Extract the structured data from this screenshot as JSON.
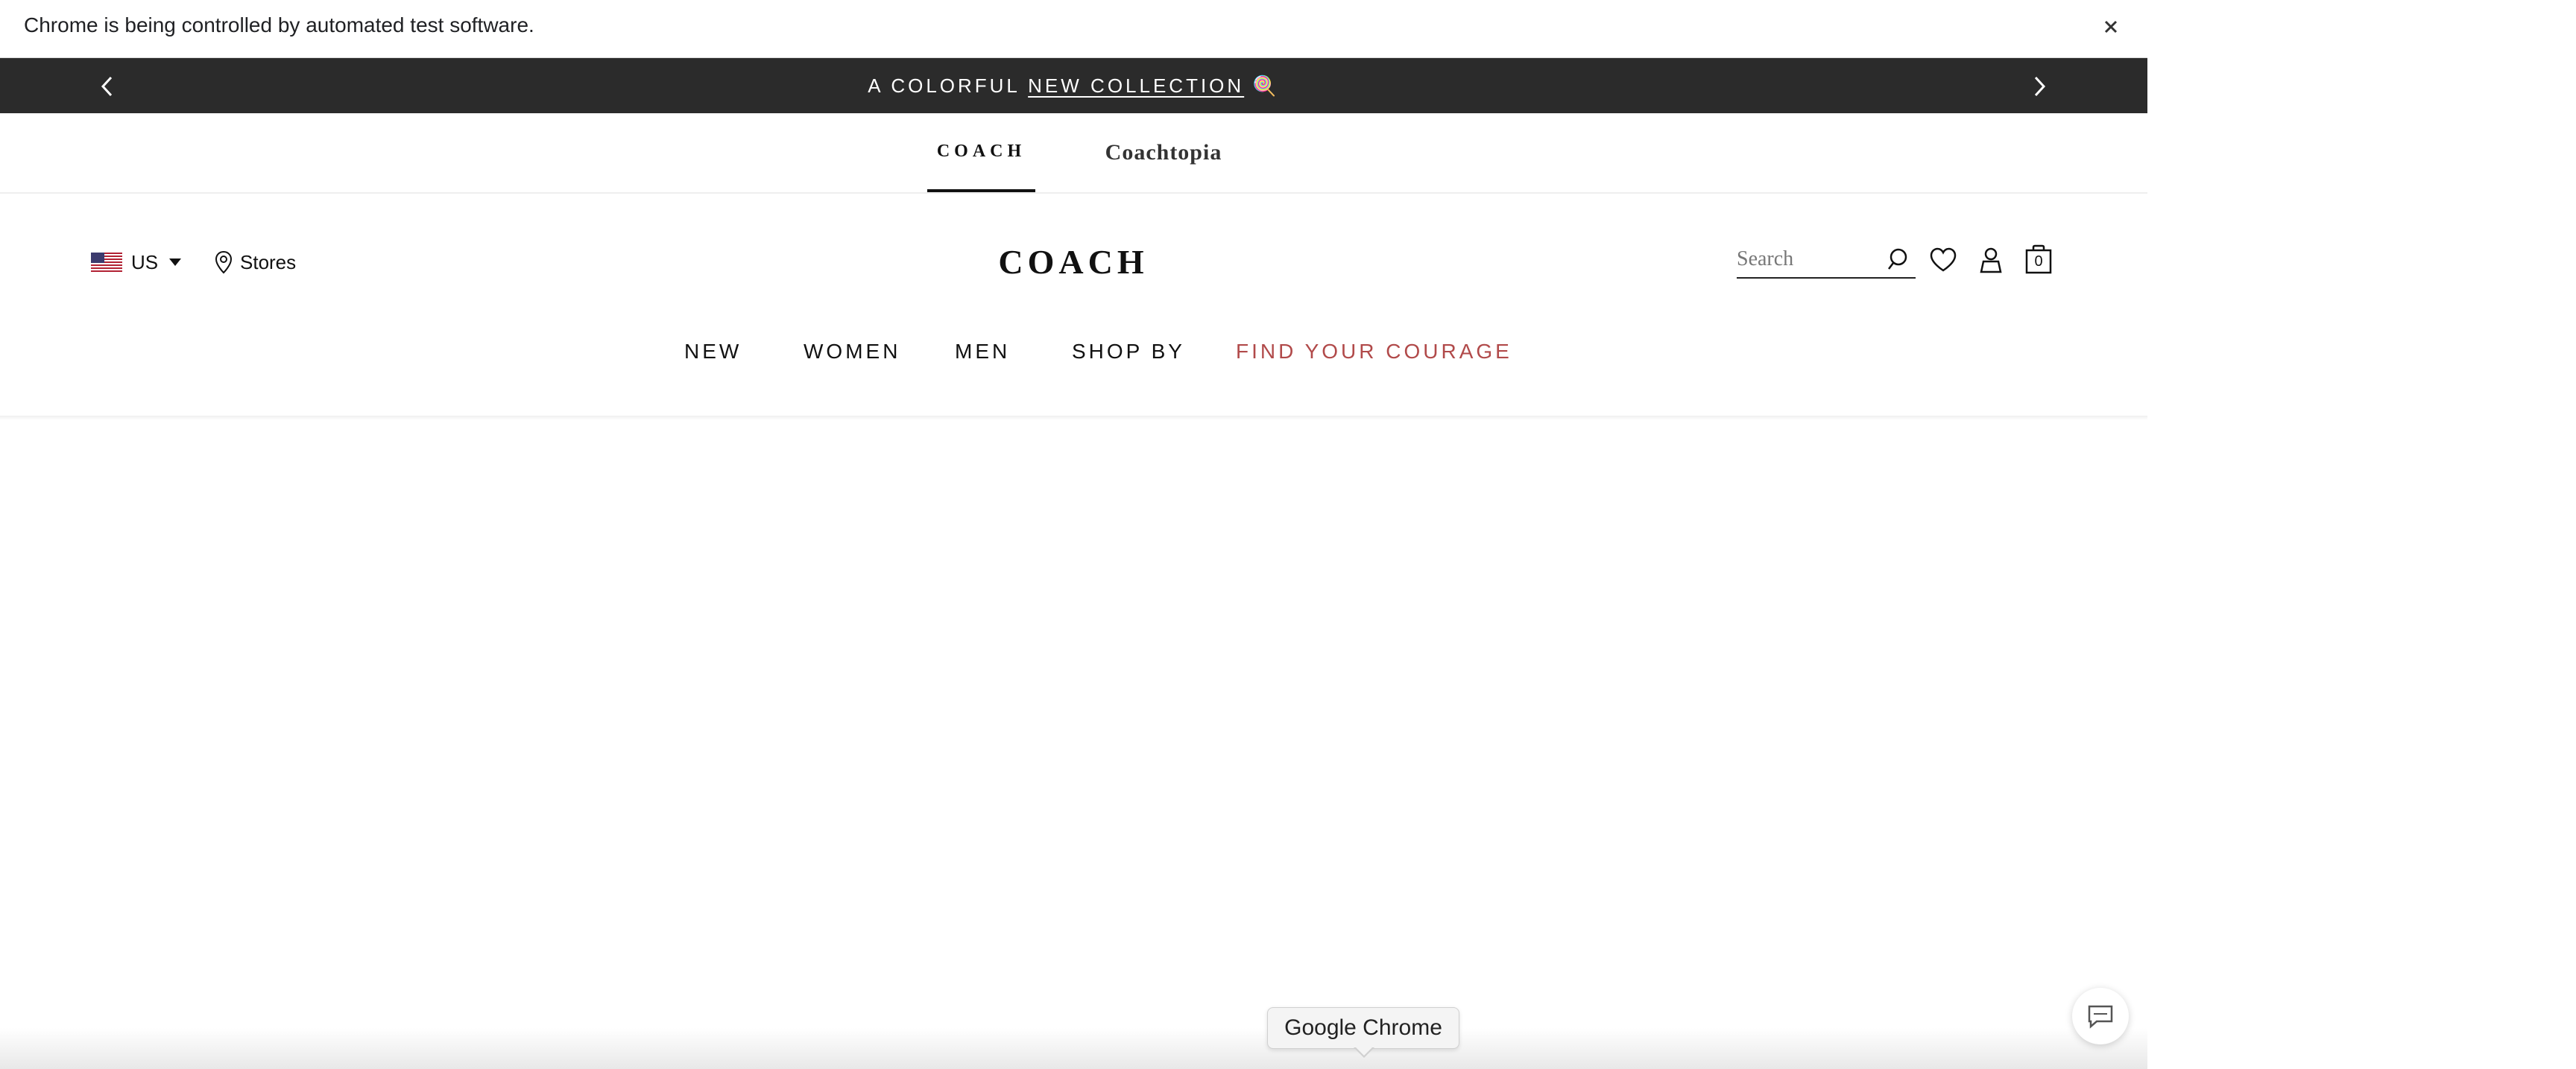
{
  "browser": {
    "infobar_text": "Chrome is being controlled by automated test software.",
    "close_icon": "close-icon",
    "tooltip": "Google Chrome"
  },
  "announcement": {
    "prefix": "A COLORFUL ",
    "link": "NEW COLLECTION",
    "suffix": " 🍭"
  },
  "brand_tabs": [
    {
      "label": "COACH",
      "active": true
    },
    {
      "label": "Coachtopia",
      "active": false
    }
  ],
  "header": {
    "locale": "US",
    "stores": "Stores",
    "logo": "COACH",
    "search_placeholder": "Search",
    "cart_count": "0"
  },
  "nav": [
    {
      "label": "NEW"
    },
    {
      "label": "WOMEN"
    },
    {
      "label": "MEN"
    },
    {
      "label": "SHOP BY"
    },
    {
      "label": "FIND YOUR COURAGE"
    }
  ],
  "colors": {
    "announcement_bg": "#2b2b2b",
    "accent": "#b14a4a"
  }
}
